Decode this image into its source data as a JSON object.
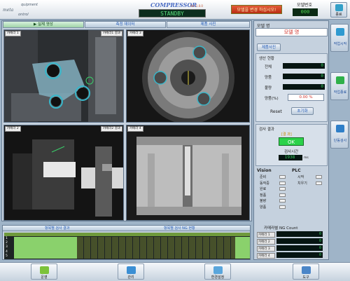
{
  "header": {
    "logo_top": "quipment",
    "logo_main": "meta",
    "logo_bottom": "ontrol",
    "title": "COMPRESSOR",
    "version": "Ver 1.0.0",
    "status": "STANDBY",
    "warning_button": "모델을 변경 하십시오!",
    "model_no_label": "모델번호",
    "model_no_value": "000",
    "exit_label": "종료"
  },
  "tabs": [
    {
      "label": "▶ 실제 영상"
    },
    {
      "label": "측정 데이터"
    },
    {
      "label": "제품 사진"
    }
  ],
  "cameras": [
    {
      "label": "카메라 1",
      "result": "카메라1 결과"
    },
    {
      "label": "카메라 3",
      "result": ""
    },
    {
      "label": "카메라 2",
      "result": "카메라2 결과"
    },
    {
      "label": "카메라 4",
      "result": ""
    }
  ],
  "results_grid": {
    "title": "항목별 검사 결과",
    "ng_title": "항목별 검사 NG 현황",
    "row_numbers": [
      "1",
      "2",
      "3",
      "4",
      "5"
    ]
  },
  "side": {
    "model_label": "모델 명",
    "model_value": "모델 명",
    "product_photo_button": "제품사진",
    "production_title": "생산 현황",
    "total_label": "전체",
    "total_value": "0",
    "ok_label": "양품",
    "ok_value": "0",
    "ng_label": "불량",
    "ng_value": "0",
    "yield_label": "양품(%)",
    "yield_value": "0.00 %",
    "reset_label": "Reset",
    "reset_button": "초기화",
    "result_title": "검사 결과",
    "result_tag": "[결 과]",
    "result_value": "OK",
    "time_label": "검사시간",
    "time_value": "1938",
    "time_unit": "ms",
    "vision_title": "Vision",
    "plc_title": "PLC",
    "vision_items": [
      "준비",
      "동작중",
      "완료",
      "정품",
      "불량",
      "양품"
    ],
    "plc_items": [
      "시작",
      "치우기"
    ],
    "ng_count_title": "카메라별 NG Count",
    "ng_items": [
      {
        "label": "카메라 1",
        "value": "0"
      },
      {
        "label": "카메라 2",
        "value": "0"
      },
      {
        "label": "카메라 3",
        "value": "0"
      },
      {
        "label": "카메라 4",
        "value": "0"
      }
    ]
  },
  "right_buttons": [
    {
      "label": "작업시작"
    },
    {
      "label": "작업종료"
    },
    {
      "label": "단동검사"
    }
  ],
  "bottom_buttons": [
    {
      "label": "운영"
    },
    {
      "label": "관리"
    },
    {
      "label": "환경설정"
    },
    {
      "label": "도구"
    }
  ],
  "colors": {
    "accent_blue": "#1d56b4",
    "ok_green": "#2bd24a",
    "warn_red": "#cc3a1a",
    "lcd_bg": "#061512"
  }
}
